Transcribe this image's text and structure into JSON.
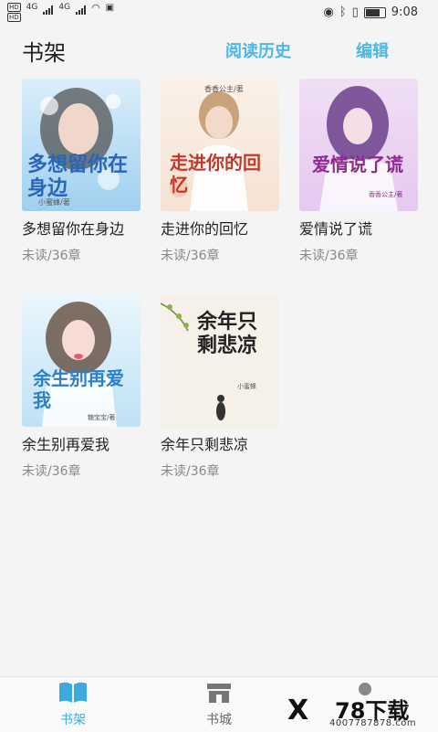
{
  "status_bar": {
    "hd1": "HD",
    "hd2": "HD",
    "net1": "4G",
    "net2": "4G",
    "time": "9:08"
  },
  "header": {
    "title": "书架",
    "history_label": "阅读历史",
    "edit_label": "编辑"
  },
  "books": [
    {
      "title": "多想留你在身边",
      "status": "未读/36章",
      "cover_text": "多想留你在身边",
      "cover_author": "小蜜蜂/著"
    },
    {
      "title": "走进你的回忆",
      "status": "未读/36章",
      "cover_text": "走进你的回忆",
      "cover_author": "香香公主/著"
    },
    {
      "title": "爱情说了谎",
      "status": "未读/36章",
      "cover_text": "爱情说了谎",
      "cover_author": "香香公主/著"
    },
    {
      "title": "余生别再爱我",
      "status": "未读/36章",
      "cover_text": "余生别再爱我",
      "cover_author": "糖宝宝/著"
    },
    {
      "title": "余年只剩悲凉",
      "status": "未读/36章",
      "cover_text": "余年只剩悲凉",
      "cover_author": "小蜜蜂"
    }
  ],
  "bottom_nav": {
    "shelf_label": "书架",
    "store_label": "书城"
  },
  "watermark": {
    "logo": "X",
    "brand": "78下载",
    "phone": "4007787878.com"
  },
  "colors": {
    "accent": "#4bb8e8",
    "nav_active": "#3da9e0",
    "background": "#f4f4f4"
  }
}
